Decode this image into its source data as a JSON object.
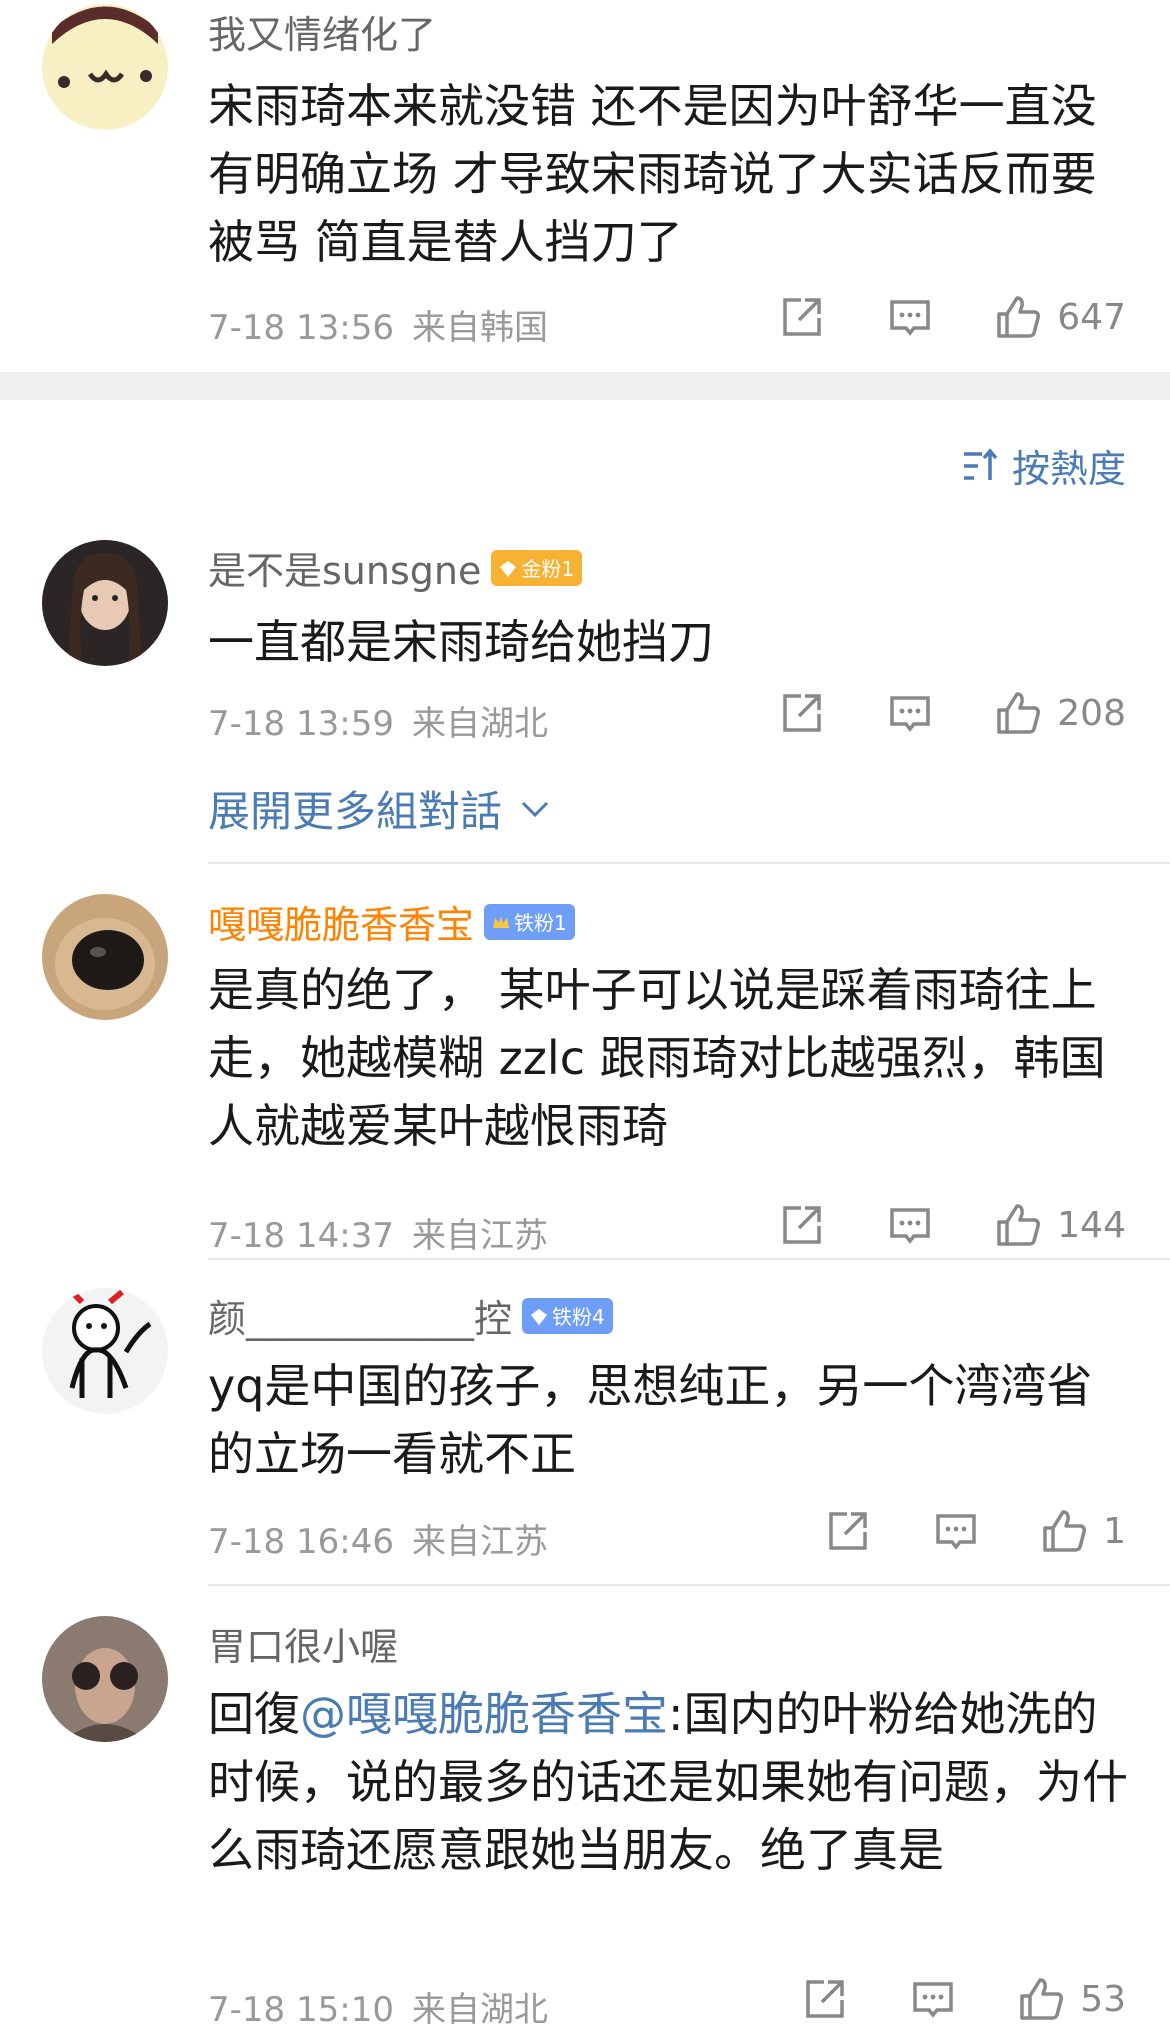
{
  "comments": [
    {
      "user": "我又情绪化了",
      "text": "宋雨琦本来就没错 还不是因为叶舒华一直没有明确立场 才导致宋雨琦说了大实话反而要被骂 简直是替人挡刀了",
      "time": "7-18 13:56",
      "source": "来自韩国",
      "likes": "647"
    },
    {
      "user": "是不是sunsgne",
      "badge": "金粉1",
      "text": "一直都是宋雨琦给她挡刀",
      "time": "7-18 13:59",
      "source": "来自湖北",
      "likes": "208"
    },
    {
      "user": "嘎嘎脆脆香香宝",
      "badge": "铁粉1",
      "text": "是真的绝了， 某叶子可以说是踩着雨琦往上走，她越模糊 zzlc 跟雨琦对比越强烈，韩国人就越爱某叶越恨雨琦",
      "time": "7-18 14:37",
      "source": "来自江苏",
      "likes": "144"
    },
    {
      "user": "颜____________控",
      "badge": "铁粉4",
      "text": "yq是中国的孩子，思想纯正，另一个湾湾省的立场一看就不正",
      "time": "7-18 16:46",
      "source": "来自江苏",
      "likes": "1"
    },
    {
      "user": "胃口很小喔",
      "reply_prefix": "回復",
      "mention": "@嘎嘎脆脆香香宝",
      "text": ":国内的叶粉给她洗的时候，说的最多的话还是如果她有问题，为什么雨琦还愿意跟她当朋友。绝了真是",
      "time": "7-18 15:10",
      "source": "来自湖北",
      "likes": "53"
    }
  ],
  "sort_label": "按熱度",
  "expand_label": "展開更多組對話",
  "colors": {
    "link": "#4a7bb5",
    "vip_name": "#ff8200",
    "meta": "#999999"
  }
}
